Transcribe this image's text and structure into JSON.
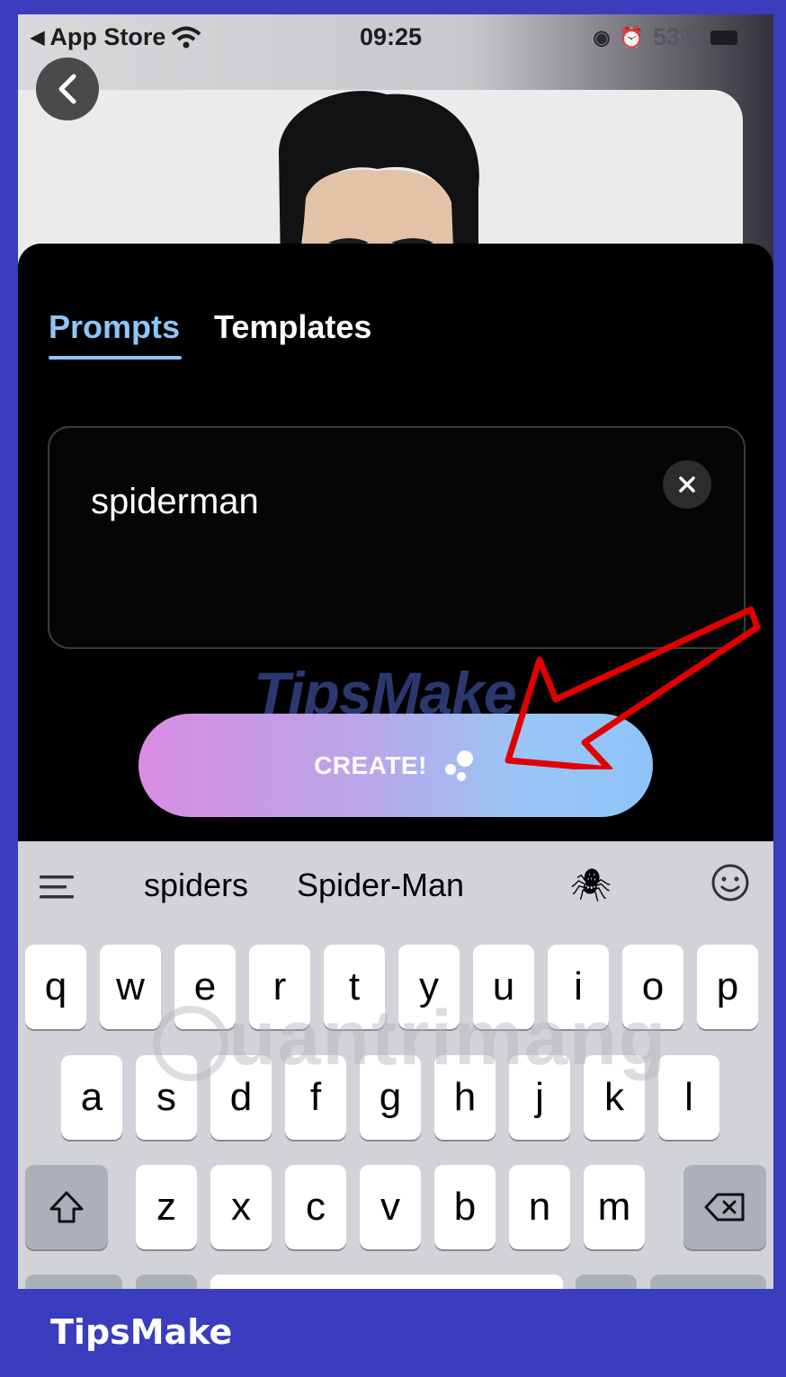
{
  "status_bar": {
    "back_app": "App Store",
    "time": "09:25",
    "battery": "53%"
  },
  "tabs": [
    {
      "label": "Prompts",
      "active": true
    },
    {
      "label": "Templates",
      "active": false
    }
  ],
  "prompt": {
    "value": "spiderman"
  },
  "create_button": {
    "label": "CREATE!"
  },
  "watermarks": {
    "tipsmake": "TipsMake",
    "quantrimang": "uantrimang"
  },
  "keyboard": {
    "suggestions": [
      "spiders",
      "Spider-Man",
      "🕷"
    ],
    "row1": [
      "q",
      "w",
      "e",
      "r",
      "t",
      "y",
      "u",
      "i",
      "o",
      "p"
    ],
    "row2": [
      "a",
      "s",
      "d",
      "f",
      "g",
      "h",
      "j",
      "k",
      "l"
    ],
    "row3": [
      "z",
      "x",
      "c",
      "v",
      "b",
      "n",
      "m"
    ]
  },
  "footer": {
    "brand": "TipsMake"
  },
  "colors": {
    "accent": "#8ec5f7",
    "frame": "#3a3dbd",
    "annotation_arrow": "#e00000"
  }
}
